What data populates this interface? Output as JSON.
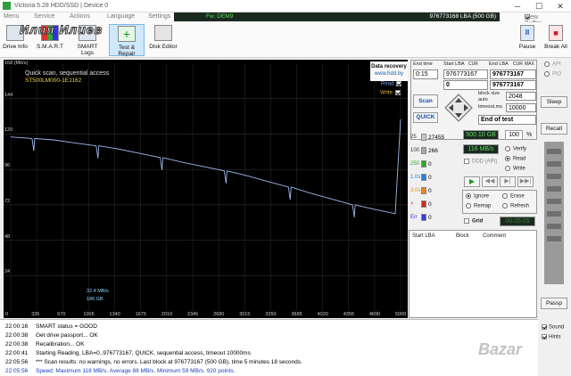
{
  "window": {
    "title": "Victoria 5.28 HDD/SSD | Device 0",
    "minimize": "─",
    "maximize": "☐",
    "close": "✕"
  },
  "menu": {
    "items": [
      "Menu",
      "Service",
      "Actions",
      "Language",
      "Settings"
    ],
    "fw": "Fw: DEM9",
    "lba": "976773168 LBA (500 GB)",
    "view_buffer": "View Buffer Live"
  },
  "toolbar": {
    "buttons": [
      "Drive Info",
      "S.M.A.R.T",
      "SMART Logs",
      "Test & Repair",
      "Disk Editor"
    ],
    "pause": "Pause",
    "break_all": "Break All"
  },
  "watermark": "Илия Илиев",
  "graph": {
    "scan_label": "Quick scan, sequential access",
    "model": "ST500LM000-1EJ162",
    "recovery": {
      "title": "Data recovery",
      "url": "www.hdd.by"
    },
    "read_label": "Read",
    "write_label": "Write",
    "y_unit": "168 (Mb/s)",
    "speed": "32.4 MB/s",
    "pos": "186 GB"
  },
  "chart_data": {
    "type": "line",
    "title": "",
    "xlabel": "",
    "ylabel": "Mb/s",
    "ylim": [
      0,
      168
    ],
    "yticks": [
      144,
      120,
      96,
      72,
      48,
      24
    ],
    "xticks": [
      "0",
      "335",
      "670",
      "1005",
      "1340",
      "1675",
      "2010",
      "2345",
      "2680",
      "3015",
      "3350",
      "3685",
      "4020",
      "4355",
      "4690",
      "5000"
    ],
    "series": [
      {
        "values": [
          118,
          117,
          116,
          114,
          112,
          110,
          107,
          104,
          101,
          98,
          95,
          92,
          88,
          84,
          80,
          76,
          72,
          69,
          66,
          130
        ]
      }
    ]
  },
  "controls": {
    "end_time_label": "End time",
    "start_lba_label": "Start LBA",
    "cur_label": "CUR",
    "end_lba_label": "End LBA",
    "cur2_label": "CUR",
    "max_label": "MAX",
    "time_value": "0:15",
    "start_lba": "976773167",
    "start_lba2": "976773167",
    "end_lba": "976773167",
    "zero": "0",
    "scan_btn": "Scan",
    "quick_btn": "QUICK",
    "block_size_label": "block size",
    "block_auto": "auto",
    "block_size": "2048",
    "timeout_label": "timeout,ms",
    "timeout": "10000",
    "end_of_test": "End of test",
    "api": "API",
    "pio": "PIO",
    "sleep": "Sleep",
    "recall": "Recall",
    "passp": "Passp"
  },
  "stats": {
    "blocks": [
      {
        "label": "25",
        "count": "27455",
        "color": "#c8c8c8"
      },
      {
        "label": "100",
        "count": "266",
        "color": "#a8a8a8"
      },
      {
        "label": "250",
        "count": "0",
        "color": "#2fa62f"
      },
      {
        "label": "1.0s",
        "count": "0",
        "color": "#2d7fd3"
      },
      {
        "label": "3.0s",
        "count": "0",
        "color": "#e08a1c"
      },
      {
        "label": ">",
        "count": "0",
        "color": "#d0281f"
      },
      {
        "label": "Err",
        "count": "0",
        "color": "#3a3ad8"
      }
    ],
    "size": "500.10 GB",
    "percent": "100",
    "pct_sym": "%",
    "speed": "116 MB/s",
    "ddd": "DDD (API)",
    "verify": "Verify",
    "read": "Read",
    "write": "Write",
    "ignore": "Ignore",
    "erase": "Erase",
    "remap": "Remap",
    "refresh": "Refresh",
    "grid": "Grid",
    "timer": "00:05:05"
  },
  "table": {
    "headers": [
      "Start LBA",
      "Block",
      "Comment"
    ]
  },
  "log": [
    {
      "time": "22:00:16",
      "text": "SMART status = GOOD",
      "color": "#000"
    },
    {
      "time": "22:00:38",
      "text": "Get drive passport... OK",
      "color": "#000"
    },
    {
      "time": "22:00:38",
      "text": "Recalibration... OK",
      "color": "#000"
    },
    {
      "time": "22:00:41",
      "text": "Starting Reading, LBA=0..976773167, QUICK, sequential access, timeout 10000ms",
      "color": "#000"
    },
    {
      "time": "22:05:56",
      "text": "*** Scan results: no warnings, no errors. Last block at 976773167 (500 GB), time 5 minutes 18 seconds.",
      "color": "#000"
    },
    {
      "time": "22:05:56",
      "text": "Speed: Maximum 118 MB/s. Average 88 MB/s. Minimum 59 MB/s. 920 points.",
      "color": "#1a3fbf"
    }
  ],
  "bottom": {
    "sound": "Sound",
    "hints": "Hints"
  },
  "brand": "Bazar"
}
